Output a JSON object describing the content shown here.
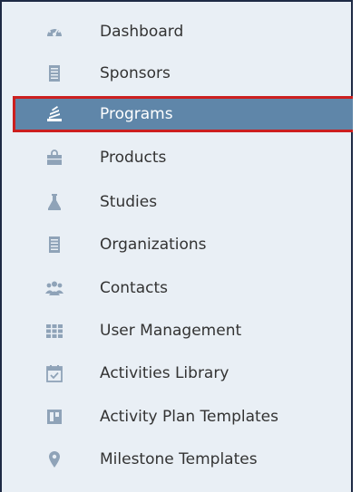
{
  "sidebar": {
    "items": [
      {
        "label": "Dashboard",
        "icon": "dashboard-gauge-icon",
        "active": false
      },
      {
        "label": "Sponsors",
        "icon": "sponsors-building-icon",
        "active": false
      },
      {
        "label": "Programs",
        "icon": "programs-stack-icon",
        "active": true
      },
      {
        "label": "Products",
        "icon": "products-bag-icon",
        "active": false
      },
      {
        "label": "Studies",
        "icon": "studies-flask-icon",
        "active": false
      },
      {
        "label": "Organizations",
        "icon": "organizations-building-icon",
        "active": false
      },
      {
        "label": "Contacts",
        "icon": "contacts-people-icon",
        "active": false
      },
      {
        "label": "User Management",
        "icon": "user-management-grid-icon",
        "active": false
      },
      {
        "label": "Activities Library",
        "icon": "activities-calendar-icon",
        "active": false
      },
      {
        "label": "Activity Plan Templates",
        "icon": "activity-plan-templates-icon",
        "active": false
      },
      {
        "label": "Milestone Templates",
        "icon": "milestone-pin-icon",
        "active": false
      }
    ]
  },
  "colors": {
    "sidebar_bg": "#e9eff5",
    "active_bg": "#5f86a9",
    "highlight_border": "#cc1f1f",
    "icon_color": "#8fa3b8",
    "text_color": "#333333"
  }
}
